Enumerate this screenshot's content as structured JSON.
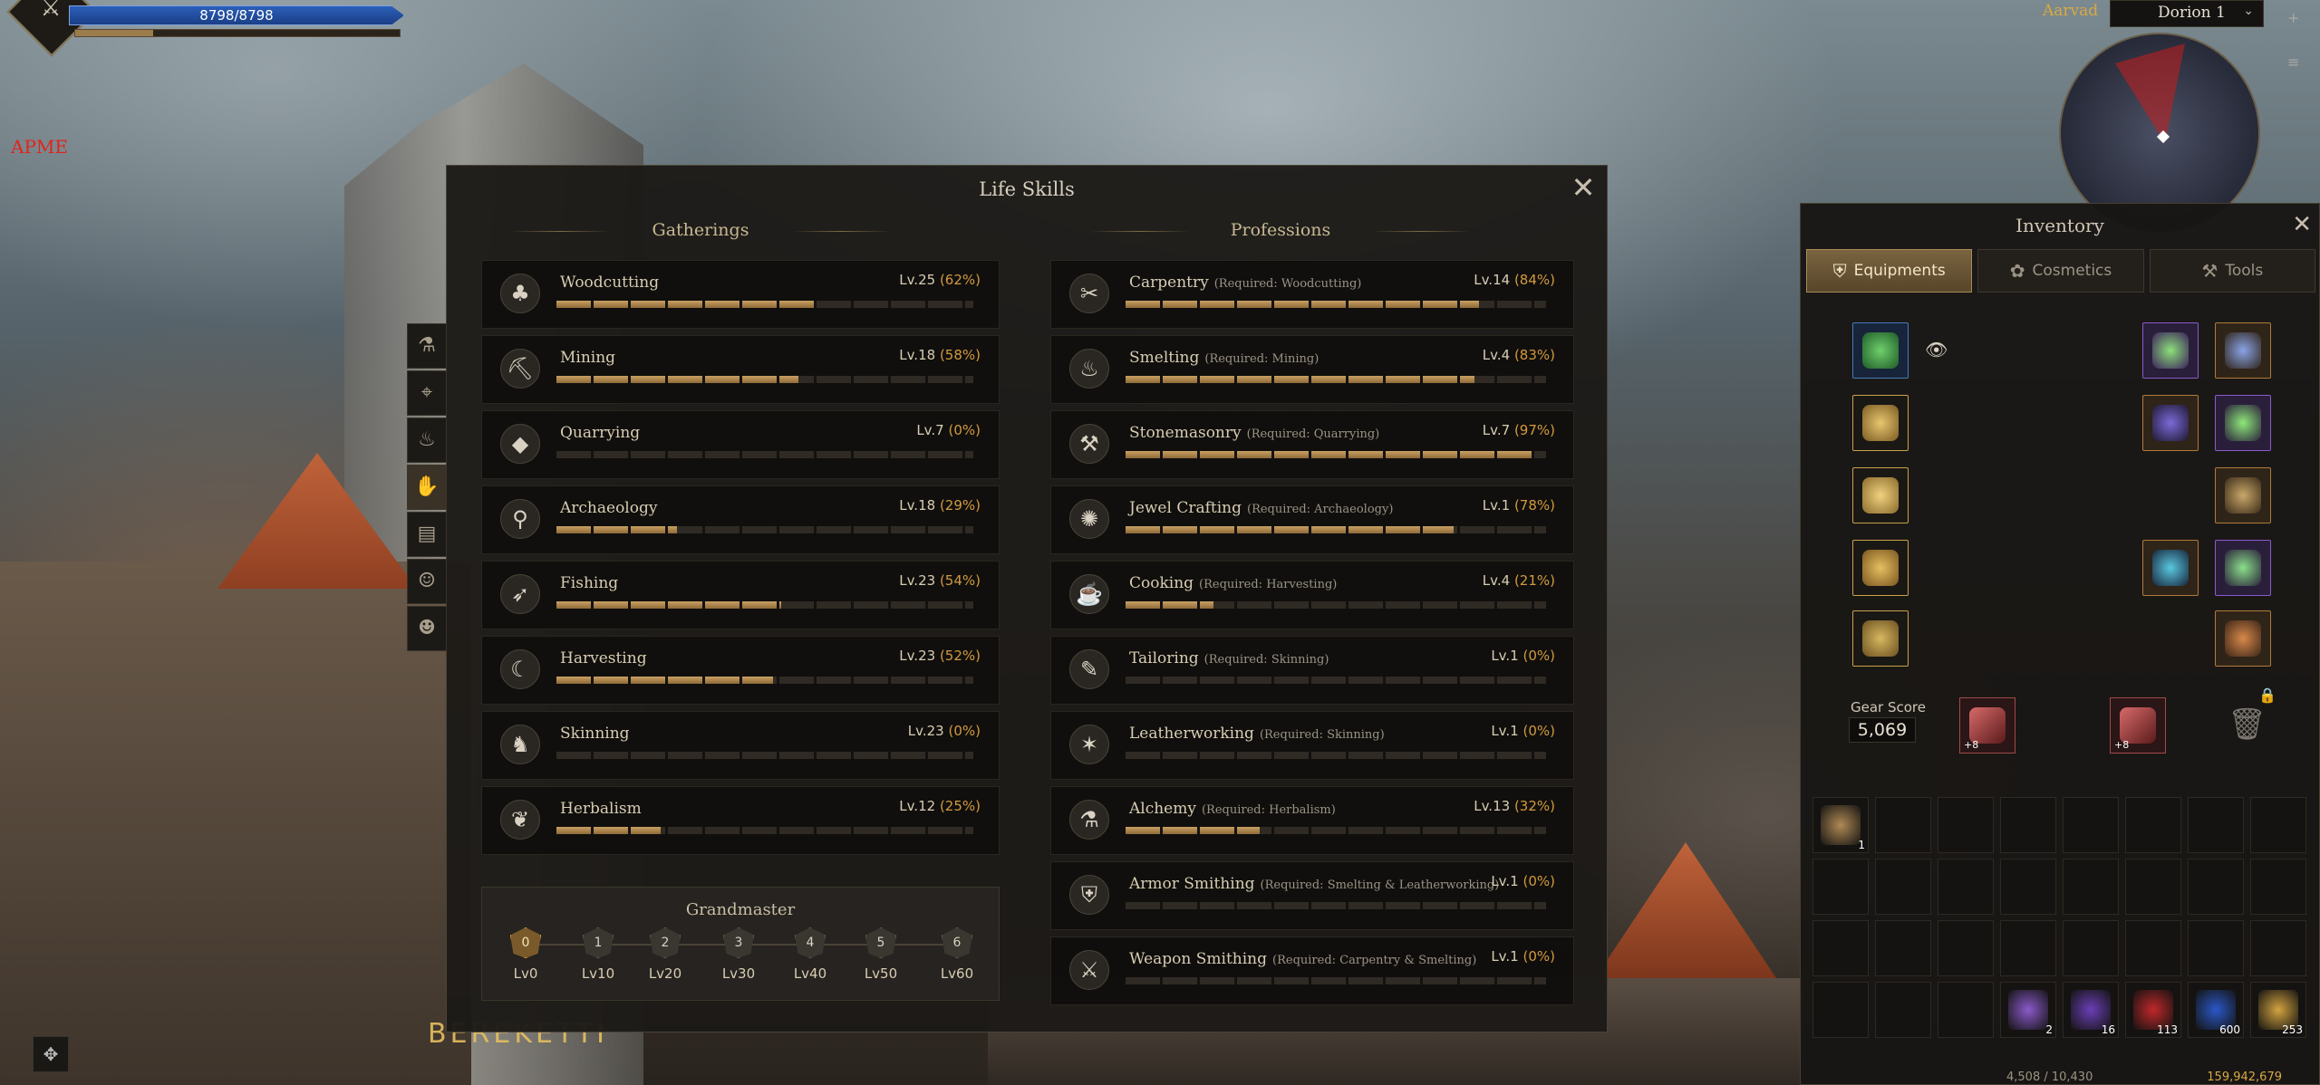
{
  "hud": {
    "hp_text": "8798/8798",
    "mp_fraction": 0.24,
    "apme_label": "APME",
    "emblem_icon": "crossed-weapons-icon"
  },
  "top_right": {
    "player_name": "Aarvad",
    "channel": "Dorion 1"
  },
  "life_skills": {
    "title": "Life Skills",
    "gatherings_header": "Gatherings",
    "professions_header": "Professions",
    "side_tabs": [
      "flask-icon",
      "map-icon",
      "lamp-icon",
      "hands-icon",
      "book-icon",
      "people-icon",
      "mask-icon"
    ],
    "active_side_tab": 3,
    "gatherings": [
      {
        "name": "Woodcutting",
        "level": "Lv.25",
        "percent": "(62%)",
        "progress": 0.62,
        "icon": "tree-icon"
      },
      {
        "name": "Mining",
        "level": "Lv.18",
        "percent": "(58%)",
        "progress": 0.58,
        "icon": "pickaxe-icon"
      },
      {
        "name": "Quarrying",
        "level": "Lv.7",
        "percent": "(0%)",
        "progress": 0.0,
        "icon": "stone-icon"
      },
      {
        "name": "Archaeology",
        "level": "Lv.18",
        "percent": "(29%)",
        "progress": 0.29,
        "icon": "shovel-icon"
      },
      {
        "name": "Fishing",
        "level": "Lv.23",
        "percent": "(54%)",
        "progress": 0.54,
        "icon": "fish-icon"
      },
      {
        "name": "Harvesting",
        "level": "Lv.23",
        "percent": "(52%)",
        "progress": 0.52,
        "icon": "sickle-icon"
      },
      {
        "name": "Skinning",
        "level": "Lv.23",
        "percent": "(0%)",
        "progress": 0.0,
        "icon": "beast-icon"
      },
      {
        "name": "Herbalism",
        "level": "Lv.12",
        "percent": "(25%)",
        "progress": 0.25,
        "icon": "herb-icon"
      }
    ],
    "professions": [
      {
        "name": "Carpentry",
        "requirement": "(Required: Woodcutting)",
        "level": "Lv.14",
        "percent": "(84%)",
        "progress": 0.84,
        "icon": "saw-icon"
      },
      {
        "name": "Smelting",
        "requirement": "(Required: Mining)",
        "level": "Lv.4",
        "percent": "(83%)",
        "progress": 0.83,
        "icon": "furnace-icon"
      },
      {
        "name": "Stonemasonry",
        "requirement": "(Required: Quarrying)",
        "level": "Lv.7",
        "percent": "(97%)",
        "progress": 0.97,
        "icon": "chisel-icon"
      },
      {
        "name": "Jewel Crafting",
        "requirement": "(Required: Archaeology)",
        "level": "Lv.1",
        "percent": "(78%)",
        "progress": 0.78,
        "icon": "gem-icon"
      },
      {
        "name": "Cooking",
        "requirement": "(Required: Harvesting)",
        "level": "Lv.4",
        "percent": "(21%)",
        "progress": 0.21,
        "icon": "pot-icon"
      },
      {
        "name": "Tailoring",
        "requirement": "(Required: Skinning)",
        "level": "Lv.1",
        "percent": "(0%)",
        "progress": 0.0,
        "icon": "needle-icon"
      },
      {
        "name": "Leatherworking",
        "requirement": "(Required: Skinning)",
        "level": "Lv.1",
        "percent": "(0%)",
        "progress": 0.0,
        "icon": "hide-icon"
      },
      {
        "name": "Alchemy",
        "requirement": "(Required: Herbalism)",
        "level": "Lv.13",
        "percent": "(32%)",
        "progress": 0.32,
        "icon": "flask-icon"
      },
      {
        "name": "Armor Smithing",
        "requirement": "(Required: Smelting & Leatherworking)",
        "level": "Lv.1",
        "percent": "(0%)",
        "progress": 0.0,
        "icon": "armor-icon"
      },
      {
        "name": "Weapon Smithing",
        "requirement": "(Required: Carpentry & Smelting)",
        "level": "Lv.1",
        "percent": "(0%)",
        "progress": 0.0,
        "icon": "sword-icon"
      }
    ],
    "grandmaster": {
      "title": "Grandmaster",
      "current_index": 0,
      "steps": [
        {
          "badge": "0",
          "label": "Lv0"
        },
        {
          "badge": "1",
          "label": "Lv10"
        },
        {
          "badge": "2",
          "label": "Lv20"
        },
        {
          "badge": "3",
          "label": "Lv30"
        },
        {
          "badge": "4",
          "label": "Lv40"
        },
        {
          "badge": "5",
          "label": "Lv50"
        },
        {
          "badge": "6",
          "label": "Lv60"
        }
      ]
    }
  },
  "inventory": {
    "title": "Inventory",
    "tabs": [
      {
        "label": "Equipments",
        "icon": "armor-tab-icon",
        "active": true
      },
      {
        "label": "Cosmetics",
        "icon": "cosmetics-tab-icon",
        "active": false
      },
      {
        "label": "Tools",
        "icon": "tools-tab-icon",
        "active": false
      }
    ],
    "gear_score_label": "Gear Score",
    "gear_score": "5,069",
    "weapons": [
      {
        "name": "main-weapon",
        "enhance": "+8"
      },
      {
        "name": "off-weapon",
        "enhance": "+8"
      }
    ],
    "bag_items": [
      {
        "slot": 0,
        "qty": "1",
        "color": "#b08a55"
      },
      {
        "slot": 27,
        "qty": "2",
        "color": "#8a5acb"
      },
      {
        "slot": 28,
        "qty": "16",
        "color": "#6a3fb8"
      },
      {
        "slot": 29,
        "qty": "113",
        "color": "#c0282a"
      },
      {
        "slot": 30,
        "qty": "600",
        "color": "#2a58c8"
      },
      {
        "slot": 31,
        "qty": "253",
        "color": "#d3a340"
      }
    ],
    "bag_slots": 32,
    "weight": "4,508 / 10,430",
    "silver": "159,942,679"
  },
  "world_text": "BEREKETTI"
}
